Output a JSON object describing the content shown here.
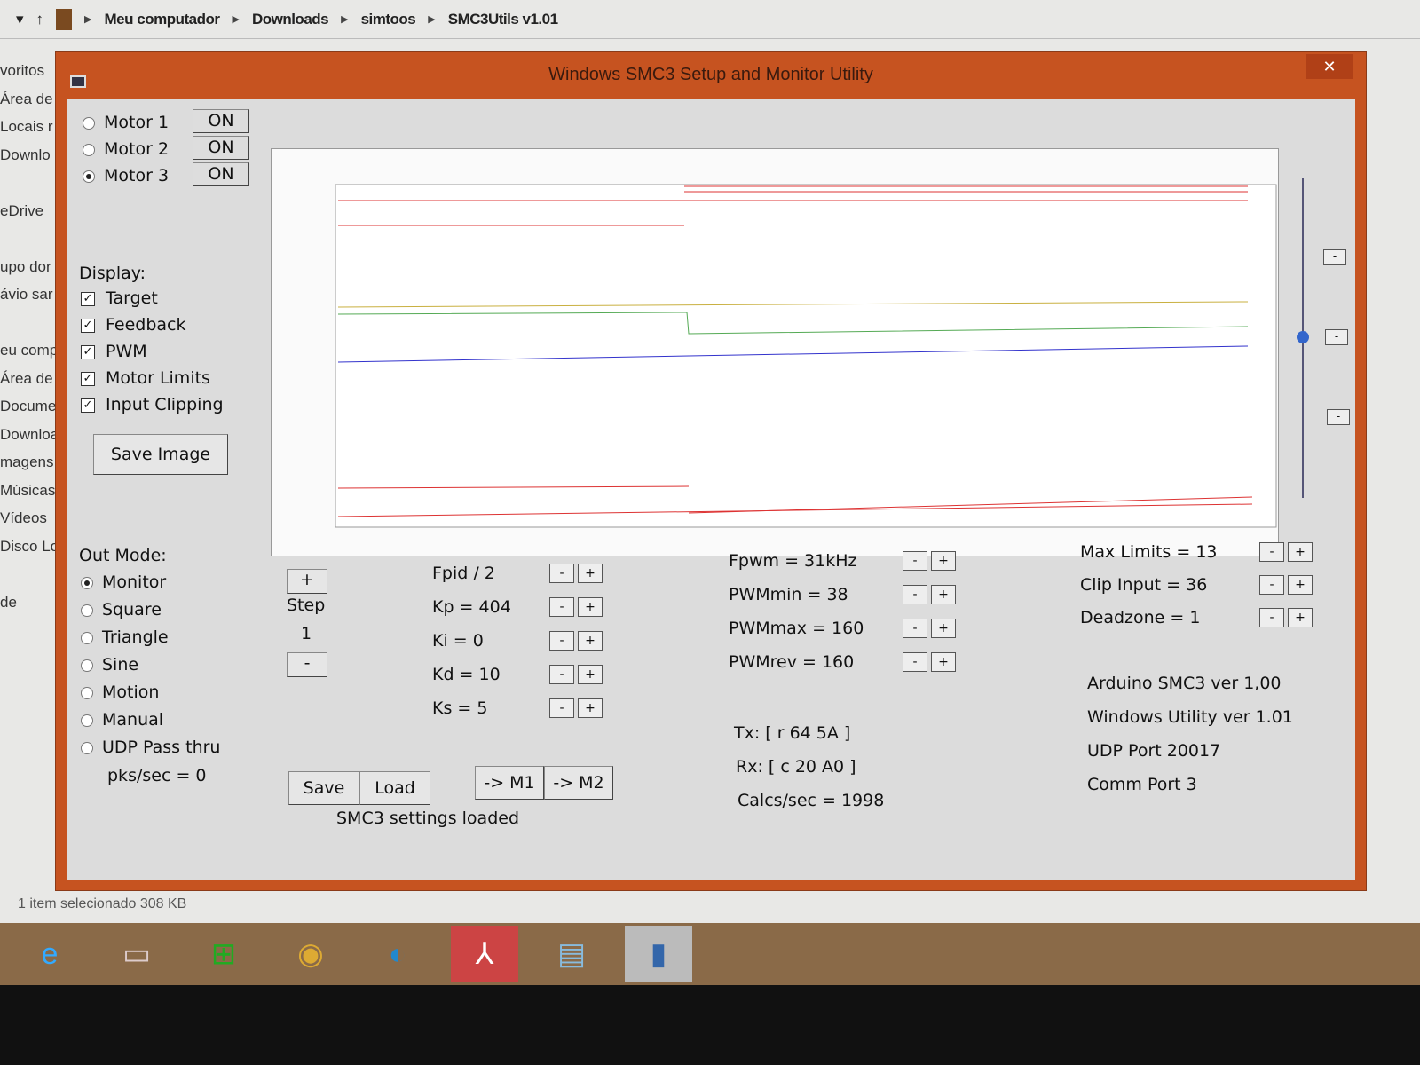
{
  "explorer": {
    "breadcrumb": [
      "Meu computador",
      "Downloads",
      "simtoos",
      "SMC3Utils v1.01"
    ],
    "nav": [
      "voritos",
      "Área de",
      "Locais r",
      "Downlo",
      "",
      "eDrive",
      "",
      "upo dor",
      "ávio sar",
      "",
      "eu comp",
      "Área de",
      "Docume",
      "Downloa",
      "magens",
      "Músicas",
      "Vídeos",
      "Disco Lo",
      "",
      "de"
    ],
    "status": "1 item selecionado  308 KB"
  },
  "window": {
    "title": "Windows SMC3 Setup and Monitor Utility",
    "close": "✕"
  },
  "motors": [
    {
      "label": "Motor 1",
      "state": "ON",
      "selected": false
    },
    {
      "label": "Motor 2",
      "state": "ON",
      "selected": false
    },
    {
      "label": "Motor 3",
      "state": "ON",
      "selected": true
    }
  ],
  "display": {
    "label": "Display:",
    "items": [
      "Target",
      "Feedback",
      "PWM",
      "Motor Limits",
      "Input Clipping"
    ],
    "save_image": "Save Image"
  },
  "outmode": {
    "label": "Out Mode:",
    "items": [
      "Monitor",
      "Square",
      "Triangle",
      "Sine",
      "Motion",
      "Manual",
      "UDP Pass thru"
    ],
    "selected": 0,
    "pks": "pks/sec = 0"
  },
  "step": {
    "plus": "+",
    "label": "Step",
    "value": "1",
    "minus": "-"
  },
  "pid": [
    "Fpid / 2",
    "Kp = 404",
    "Ki = 0",
    "Kd = 10",
    "Ks = 5"
  ],
  "pwm": [
    "Fpwm = 31kHz",
    "PWMmin = 38",
    "PWMmax = 160",
    "PWMrev = 160"
  ],
  "limits": [
    "Max Limits = 13",
    "Clip Input = 36",
    "Deadzone = 1"
  ],
  "buttons": {
    "save": "Save",
    "load": "Load",
    "m1": "-> M1",
    "m2": "-> M2",
    "minus": "-",
    "plus": "+"
  },
  "status_msg": "SMC3 settings loaded",
  "comm": {
    "tx": "Tx: [ r 64 5A ]",
    "rx": "Rx: [ c 20 A0 ]",
    "calcs": "Calcs/sec = 1998"
  },
  "info": [
    "Arduino SMC3 ver 1,00",
    "Windows Utility ver 1.01",
    "UDP Port 20017",
    "Comm Port 3"
  ]
}
